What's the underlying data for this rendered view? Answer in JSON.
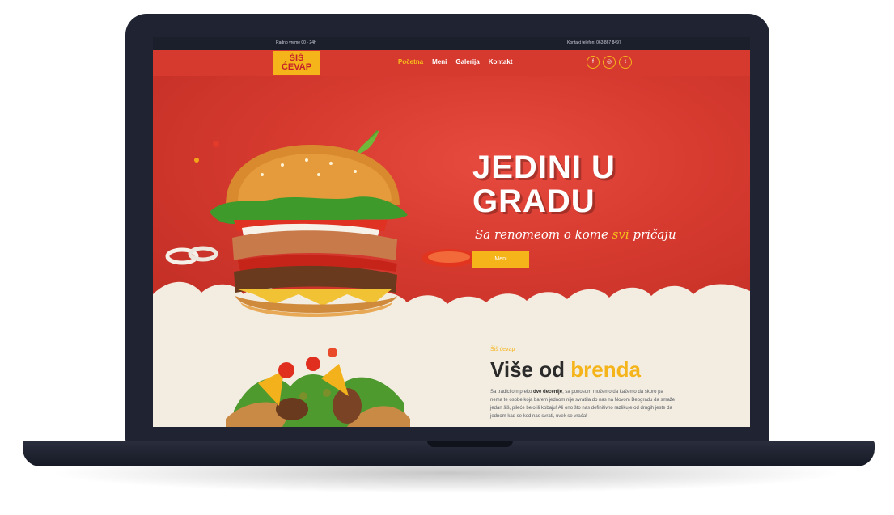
{
  "topbar": {
    "left": "Radno vreme 00 - 24h",
    "right": "Kontakt telefon: 063 867 8497"
  },
  "logo": {
    "line1": "ŠIŠ",
    "line2": "ĆEVAP"
  },
  "nav": {
    "items": [
      {
        "label": "Početna",
        "active": true
      },
      {
        "label": "Meni",
        "active": false
      },
      {
        "label": "Galerija",
        "active": false
      },
      {
        "label": "Kontakt",
        "active": false
      }
    ]
  },
  "social": {
    "items": [
      {
        "icon": "facebook-icon",
        "glyph": "f"
      },
      {
        "icon": "instagram-icon",
        "glyph": "◎"
      },
      {
        "icon": "twitter-icon",
        "glyph": "t"
      }
    ]
  },
  "hero": {
    "title_line1": "JEDINI U",
    "title_line2": "GRADU",
    "subtitle_before": "Sa renomeom o kome ",
    "subtitle_highlight": "svi",
    "subtitle_after": " pričaju",
    "button_label": "Meni"
  },
  "about": {
    "small_label": "Šiš ćevap",
    "title_part1": "Više od ",
    "title_part2": "brenda",
    "text_before": "Sa tradicijom preko ",
    "text_bold": "dve decenije",
    "text_after": ", sa ponosom možemo da kažemo da skoro pa nema te osobe koja barem jednom nije svratila do nas na Novom Beogradu da smaže jedan šiš, pileće belo ili kobaju! Ali ono što nas definitivno razlikuje od drugih jeste da jednom kad se kod nas svrati, uvek se vraća!"
  },
  "colors": {
    "brand_red": "#d63a2f",
    "brand_yellow": "#f4b41a",
    "cream": "#f3ede1",
    "dark": "#1f2332"
  }
}
